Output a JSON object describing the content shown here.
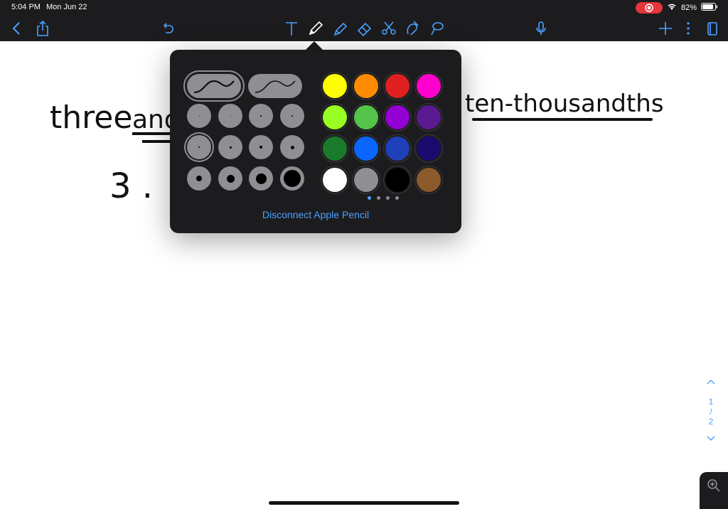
{
  "status": {
    "time": "5:04 PM",
    "date": "Mon Jun 22",
    "battery": "82%"
  },
  "canvas": {
    "line1_left": "three",
    "line1_underlined_partial": "and",
    "line1_right": "ten-thousandths",
    "line2": "3 ."
  },
  "popover": {
    "disconnect_label": "Disconnect Apple Pencil",
    "colors": [
      "#ffff00",
      "#ff8c00",
      "#e02020",
      "#ff00cc",
      "#99ff22",
      "#55c24a",
      "#9400d3",
      "#5b1a8f",
      "#1a7a2b",
      "#0a66ff",
      "#1e40b8",
      "#1a0a6e",
      "#ffffff",
      "#8e8e93",
      "#000000",
      "#8b5a2b"
    ],
    "page_count": 4,
    "active_page": 1
  },
  "page_indicator": {
    "current": "1",
    "separator": "/",
    "total": "2"
  }
}
